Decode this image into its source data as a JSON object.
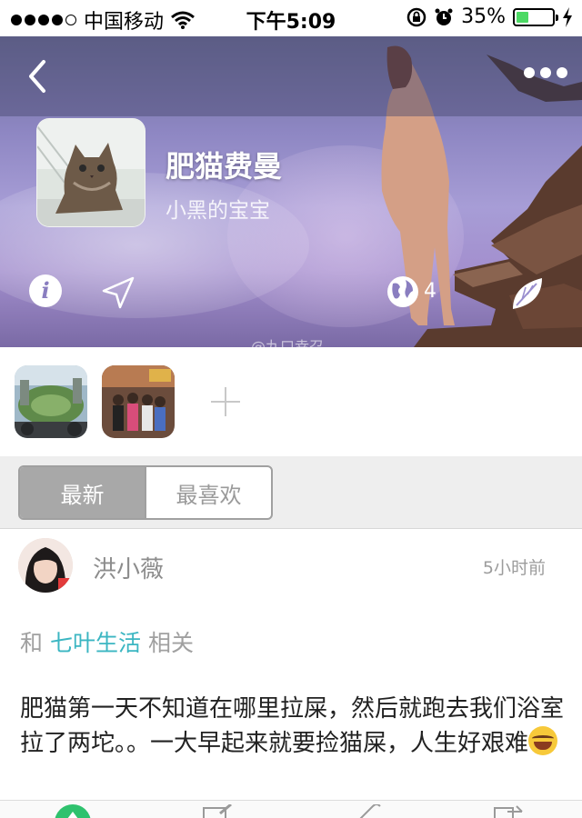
{
  "status_bar": {
    "carrier": "中国移动",
    "time": "下午5:09",
    "battery_percent": "35%",
    "battery_level": 0.35,
    "icons": [
      "signal-dots-icon",
      "wifi-icon",
      "orientation-lock-icon",
      "alarm-icon",
      "battery-icon",
      "charging-bolt-icon"
    ]
  },
  "header": {
    "title": "肥猫费曼",
    "subtitle": "小黑的宝宝",
    "location_count": "4",
    "watermark": "@九口幸召",
    "icons": [
      "back-icon",
      "more-icon",
      "info-icon",
      "location-arrow-icon",
      "globe-icon",
      "leaf-icon"
    ]
  },
  "photos": {
    "items": [
      "photo-garden",
      "photo-group"
    ],
    "add_icon": "plus-icon"
  },
  "segments": {
    "latest": "最新",
    "favorite": "最喜欢",
    "selected": "latest"
  },
  "post": {
    "user": "洪小薇",
    "time": "5小时前",
    "related_prefix": "和",
    "related_tag": "七叶生活",
    "related_suffix": "相关",
    "text": "肥猫第一天不知道在哪里拉屎，然后就跑去我们浴室拉了两坨。。一大早起来就要捡猫屎，人生好艰难",
    "emoji": "crying-laughing-emoji"
  },
  "colors": {
    "accent": "#3bb6c2",
    "segment_active": "#a8a8a8",
    "tab_green": "#2fc26e"
  }
}
